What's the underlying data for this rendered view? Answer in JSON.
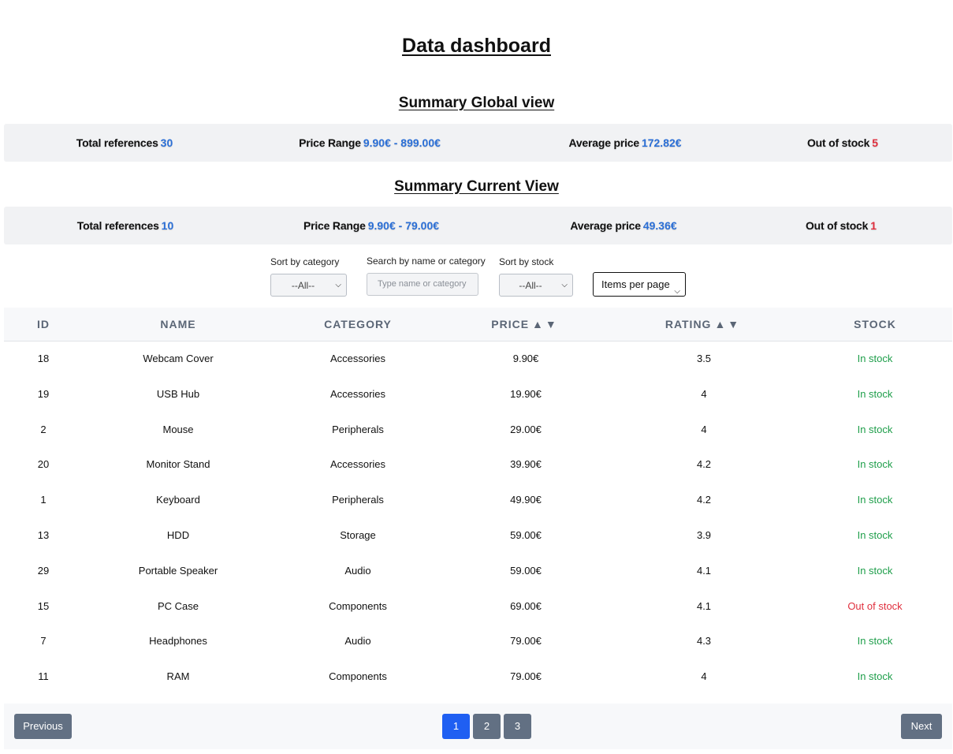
{
  "title": "Data dashboard",
  "summary_global": {
    "heading": "Summary Global view",
    "stats": [
      {
        "label": "Total references",
        "value": "30",
        "color": "#2b6fd6"
      },
      {
        "label": "Price Range",
        "value": "9.90€ - 899.00€",
        "color": "#2b6fd6"
      },
      {
        "label": "Average price",
        "value": "172.82€",
        "color": "#2b6fd6"
      },
      {
        "label": "Out of stock",
        "value": "5",
        "color": "#e0303e"
      }
    ]
  },
  "summary_current": {
    "heading": "Summary Current View",
    "stats": [
      {
        "label": "Total references",
        "value": "10",
        "color": "#2b6fd6"
      },
      {
        "label": "Price Range",
        "value": "9.90€ - 79.00€",
        "color": "#2b6fd6"
      },
      {
        "label": "Average price",
        "value": "49.36€",
        "color": "#2b6fd6"
      },
      {
        "label": "Out of stock",
        "value": "1",
        "color": "#e0303e"
      }
    ]
  },
  "controls": {
    "category_label": "Sort by category",
    "category_value": "--All--",
    "search_label": "Search by name or category",
    "search_placeholder": "Type name or category",
    "stock_label": "Sort by stock",
    "stock_value": "--All--",
    "items_per_page": "Items per page"
  },
  "table": {
    "headers": {
      "id": "ID",
      "name": "NAME",
      "category": "CATEGORY",
      "price": "PRICE",
      "rating": "RATING",
      "stock": "STOCK",
      "sort_arrows": "▲▼"
    },
    "rows": [
      {
        "id": "18",
        "name": "Webcam Cover",
        "category": "Accessories",
        "price": "9.90€",
        "rating": "3.5",
        "stock": "In stock"
      },
      {
        "id": "19",
        "name": "USB Hub",
        "category": "Accessories",
        "price": "19.90€",
        "rating": "4",
        "stock": "In stock"
      },
      {
        "id": "2",
        "name": "Mouse",
        "category": "Peripherals",
        "price": "29.00€",
        "rating": "4",
        "stock": "In stock"
      },
      {
        "id": "20",
        "name": "Monitor Stand",
        "category": "Accessories",
        "price": "39.90€",
        "rating": "4.2",
        "stock": "In stock"
      },
      {
        "id": "1",
        "name": "Keyboard",
        "category": "Peripherals",
        "price": "49.90€",
        "rating": "4.2",
        "stock": "In stock"
      },
      {
        "id": "13",
        "name": "HDD",
        "category": "Storage",
        "price": "59.00€",
        "rating": "3.9",
        "stock": "In stock"
      },
      {
        "id": "29",
        "name": "Portable Speaker",
        "category": "Audio",
        "price": "59.00€",
        "rating": "4.1",
        "stock": "In stock"
      },
      {
        "id": "15",
        "name": "PC Case",
        "category": "Components",
        "price": "69.00€",
        "rating": "4.1",
        "stock": "Out of stock"
      },
      {
        "id": "7",
        "name": "Headphones",
        "category": "Audio",
        "price": "79.00€",
        "rating": "4.3",
        "stock": "In stock"
      },
      {
        "id": "11",
        "name": "RAM",
        "category": "Components",
        "price": "79.00€",
        "rating": "4",
        "stock": "In stock"
      }
    ]
  },
  "pagination": {
    "previous": "Previous",
    "next": "Next",
    "pages": [
      "1",
      "2",
      "3"
    ],
    "current_page": "1",
    "accent": "#1f5ff2"
  },
  "colors": {
    "in_stock": "#1e9e4a",
    "out_of_stock": "#e0303e",
    "accent": "#2b6fd6"
  }
}
